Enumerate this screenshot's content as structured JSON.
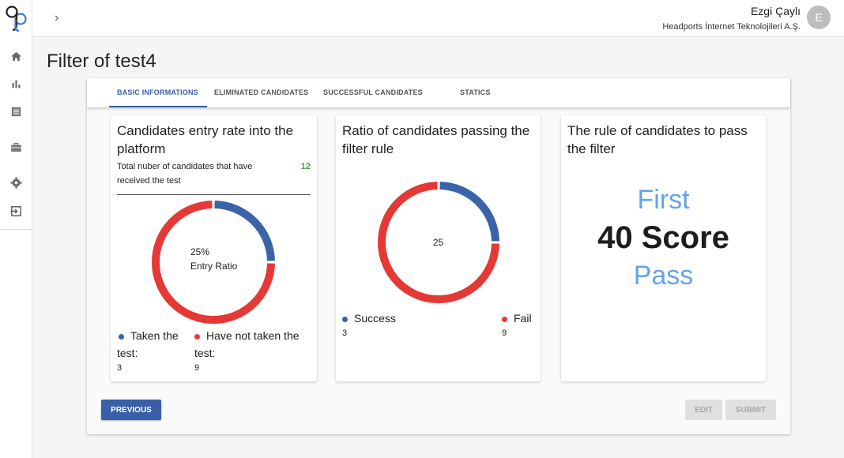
{
  "header": {
    "user_name": "Ezgi Çaylı",
    "organization": "Headports İnternet Teknolojileri A.Ş.",
    "avatar_initial": "E"
  },
  "page": {
    "title": "Filter of test4"
  },
  "tabs": [
    {
      "label": "Basic informations",
      "active": true
    },
    {
      "label": "Eliminated candidates",
      "active": false
    },
    {
      "label": "Successful candidates",
      "active": false
    },
    {
      "label": "Statics",
      "active": false
    }
  ],
  "colors": {
    "accent": "#3a5fa8",
    "success": "#3b63a8",
    "fail": "#e53935",
    "count_green": "#43a047",
    "score_blue": "#64a4e8"
  },
  "cards": {
    "entry": {
      "title": "Candidates entry rate into the platform",
      "total_label": "Total nuber of candidates that have received the test",
      "total_value": "12",
      "center_percent": "25%",
      "center_label": "Entry Ratio",
      "legend": [
        {
          "label": "Taken the test:",
          "value": "3"
        },
        {
          "label": "Have not taken the test:",
          "value": "9"
        }
      ]
    },
    "ratio": {
      "title": "Ratio of candidates passing the filter rule",
      "center_value": "25",
      "legend": [
        {
          "label": "Success",
          "value": "3"
        },
        {
          "label": "Fail",
          "value": "9"
        }
      ]
    },
    "rule": {
      "title": "The rule of candidates to pass the filter",
      "line1": "First",
      "line2": "40 Score",
      "line3": "Pass"
    }
  },
  "chart_data": [
    {
      "type": "pie",
      "categories": [
        "Taken the test:",
        "Have not taken the test:"
      ],
      "values": [
        3,
        9
      ]
    },
    {
      "type": "pie",
      "categories": [
        "Success",
        "Fail"
      ],
      "values": [
        3,
        9
      ]
    }
  ],
  "buttons": {
    "previous": "Previous",
    "edit": "Edit",
    "submit": "Submit"
  }
}
